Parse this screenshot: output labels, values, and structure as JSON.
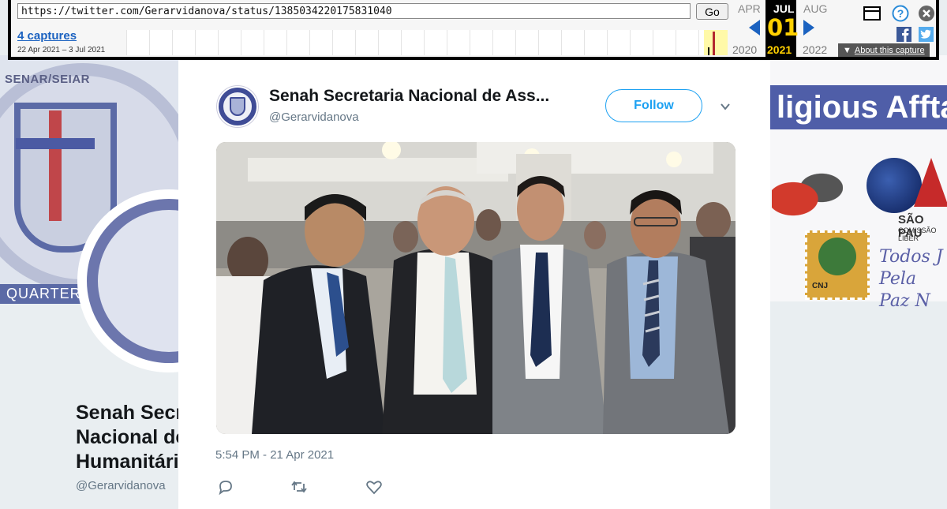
{
  "wayback": {
    "url": "https://twitter.com/Gerarvidanova/status/1385034220175831040",
    "go_label": "Go",
    "captures": "4 captures",
    "date_range": "22 Apr 2021 – 3 Jul 2021",
    "months": {
      "prev": "APR",
      "current": "JUL",
      "next": "AUG"
    },
    "day": "01",
    "years": {
      "prev": "2020",
      "current": "2021",
      "next": "2022"
    },
    "about_label": "About this capture"
  },
  "background": {
    "brand_label": "SENAR/SEIAR",
    "quarters_label": "QUARTERS",
    "banner_title": "ligious Affta",
    "sao_label": "SÃO PAU",
    "comissao_label": "COMISSÃO LIBER",
    "motto_line1": "Todos J",
    "motto_line2": "Pela Paz N",
    "stamp_label": "CNJ",
    "profile_name_line1": "Senah Secre",
    "profile_name_line2": "Nacional de",
    "profile_name_line3": "Humanitári",
    "profile_handle": "@Gerarvidanova"
  },
  "tweet": {
    "author_name": "Senah Secretaria Nacional de Ass...",
    "author_handle": "@Gerarvidanova",
    "follow_label": "Follow",
    "timestamp": "5:54 PM - 21 Apr 2021"
  },
  "colors": {
    "twitter_blue": "#1da1f2",
    "wayback_link": "#1b62c0",
    "muted_text": "#657786"
  },
  "icons": {
    "reply": "reply-icon",
    "retweet": "retweet-icon",
    "like": "like-icon",
    "more": "chevron-down-icon"
  }
}
